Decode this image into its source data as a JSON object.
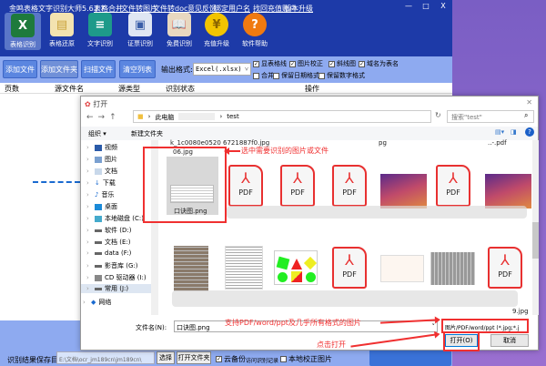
{
  "window": {
    "title": "金鸣表格文字识别大师5.63.7",
    "links": [
      "表格合并",
      "文件转图片",
      "文件转doc",
      "意见反馈",
      "绑定用户名",
      "找回充值账户",
      "版本升级"
    ],
    "controls": [
      "—",
      "□",
      "X"
    ]
  },
  "ribbon": [
    {
      "label": "表格识别",
      "icon": "excel-icon"
    },
    {
      "label": "表格还原",
      "icon": "table-restore-icon"
    },
    {
      "label": "文字识别",
      "icon": "text-doc-icon"
    },
    {
      "label": "证票识别",
      "icon": "id-card-icon"
    },
    {
      "label": "免费识别",
      "icon": "book-icon"
    },
    {
      "label": "充值升级",
      "icon": "yuan-coin-icon"
    },
    {
      "label": "软件帮助",
      "icon": "help-icon"
    }
  ],
  "toolbar": {
    "buttons": [
      "添加文件",
      "添加文件夹",
      "扫描文件",
      "清空列表"
    ],
    "format_label": "输出格式:",
    "format_value": "Excel(.xlsx)",
    "checks": [
      {
        "label": "显表格线",
        "checked": true
      },
      {
        "label": "图片校正",
        "checked": true
      },
      {
        "label": "斜线图",
        "checked": true
      },
      {
        "label": "域名为表名",
        "checked": true
      },
      {
        "label": "合并",
        "checked": false
      },
      {
        "label": "保留日期格式",
        "checked": false
      },
      {
        "label": "保留数字格式",
        "checked": false
      }
    ]
  },
  "table": {
    "headers": [
      "页数",
      "源文件名",
      "源类型",
      "识别状态",
      "操作"
    ]
  },
  "dialog": {
    "title": "打开",
    "path": [
      "此电脑",
      "test"
    ],
    "search_placeholder": "搜索\"test\"",
    "organize": "组织 ▾",
    "new_folder": "新建文件夹",
    "nav": [
      "视频",
      "图片",
      "文档",
      "下载",
      "音乐",
      "桌面",
      "本地磁盘 (C:)",
      "软件 (D:)",
      "文档 (E:)",
      "data (F:)",
      "影音库 (G:)",
      "CD 驱动器 (I:)",
      "常用 (J:)",
      "网络"
    ],
    "top_captions": [
      "k_1c0080e0520",
      "6721887f0.jpg",
      "pg",
      "..-.pdf"
    ],
    "selected_caption_top": "06.jpg",
    "selected_name": "口诀图.png",
    "pdf_label": "PDF",
    "row2_caption": "9.jpg",
    "filename_label": "文件名(N):",
    "filename_value": "口诀图.png",
    "filetype_value": "图片/PDF/word/ppt (*.jpg;*.j",
    "open": "打开(O)",
    "cancel": "取消"
  },
  "annotations": {
    "select": "选中需要识别的图片或文件",
    "support": "支持PDF/word/ppt及几乎所有格式的图片",
    "click_open": "点击打开",
    "color": "#f03030"
  },
  "bottom": {
    "save_label": "识别结果保存目录:",
    "save_path": "E:\\文档\\ocr_jm189cn\\jm189cn\\",
    "choose": "选择",
    "open_folder": "打开文件夹",
    "cloud_backup": "云备份",
    "cloud_checked": true,
    "visit_records": "访问识别记录",
    "local_correct": "本地校正图片",
    "local_checked": false
  }
}
